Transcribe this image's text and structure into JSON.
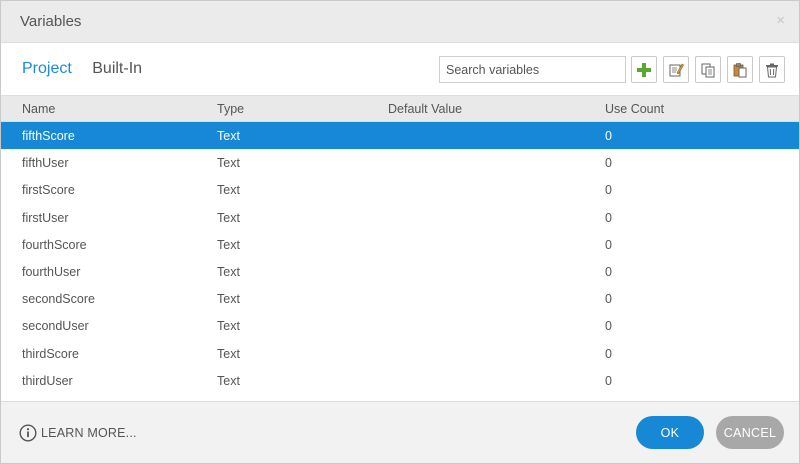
{
  "dialog": {
    "title": "Variables",
    "close_glyph": "×"
  },
  "tabs": [
    {
      "label": "Project",
      "active": true
    },
    {
      "label": "Built-In",
      "active": false
    }
  ],
  "search": {
    "placeholder": "Search variables",
    "value": ""
  },
  "toolbar": {
    "buttons": [
      {
        "name": "add",
        "icon": "plus-icon"
      },
      {
        "name": "edit",
        "icon": "edit-icon"
      },
      {
        "name": "copy",
        "icon": "copy-icon"
      },
      {
        "name": "paste",
        "icon": "paste-icon"
      },
      {
        "name": "delete",
        "icon": "trash-icon"
      }
    ]
  },
  "columns": {
    "name": "Name",
    "type": "Type",
    "default_value": "Default Value",
    "use_count": "Use Count"
  },
  "rows": [
    {
      "name": "fifthScore",
      "type": "Text",
      "default_value": "",
      "use_count": "0",
      "selected": true
    },
    {
      "name": "fifthUser",
      "type": "Text",
      "default_value": "",
      "use_count": "0",
      "selected": false
    },
    {
      "name": "firstScore",
      "type": "Text",
      "default_value": "",
      "use_count": "0",
      "selected": false
    },
    {
      "name": "firstUser",
      "type": "Text",
      "default_value": "",
      "use_count": "0",
      "selected": false
    },
    {
      "name": "fourthScore",
      "type": "Text",
      "default_value": "",
      "use_count": "0",
      "selected": false
    },
    {
      "name": "fourthUser",
      "type": "Text",
      "default_value": "",
      "use_count": "0",
      "selected": false
    },
    {
      "name": "secondScore",
      "type": "Text",
      "default_value": "",
      "use_count": "0",
      "selected": false
    },
    {
      "name": "secondUser",
      "type": "Text",
      "default_value": "",
      "use_count": "0",
      "selected": false
    },
    {
      "name": "thirdScore",
      "type": "Text",
      "default_value": "",
      "use_count": "0",
      "selected": false
    },
    {
      "name": "thirdUser",
      "type": "Text",
      "default_value": "",
      "use_count": "0",
      "selected": false
    }
  ],
  "footer": {
    "learn_more": "LEARN MORE...",
    "ok": "OK",
    "cancel": "CANCEL"
  },
  "colors": {
    "accent": "#1788d6",
    "cancel": "#a8a8a8",
    "add_icon": "#5aa832"
  }
}
